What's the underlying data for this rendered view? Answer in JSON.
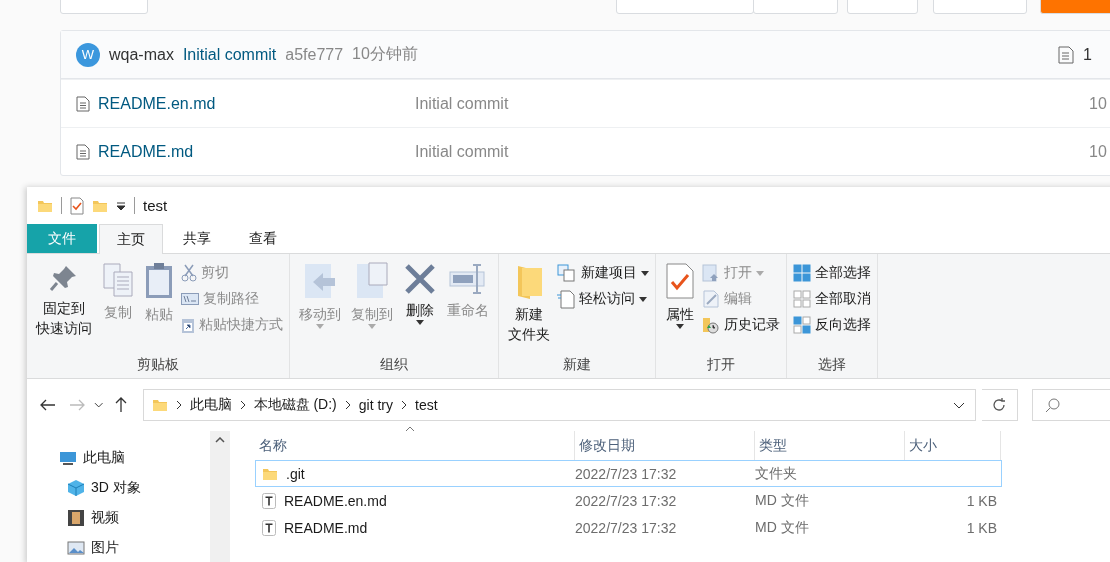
{
  "repo": {
    "commit": {
      "avatar": "W",
      "author": "wqa-max",
      "message": "Initial commit",
      "hash": "a5fe777",
      "time": "10分钟前",
      "count": "1"
    },
    "files": [
      {
        "name": "README.en.md",
        "message": "Initial commit",
        "time": "10"
      },
      {
        "name": "README.md",
        "message": "Initial commit",
        "time": "10"
      }
    ]
  },
  "explorer": {
    "title": "test",
    "tabs": [
      {
        "label": "文件",
        "kind": "file",
        "selected": false
      },
      {
        "label": "主页",
        "kind": "tab",
        "selected": true
      },
      {
        "label": "共享",
        "kind": "tab",
        "selected": false
      },
      {
        "label": "查看",
        "kind": "tab",
        "selected": false
      }
    ],
    "ribbon_groups": [
      {
        "label": "剪贴板",
        "columns": [
          {
            "kind": "large",
            "items": [
              {
                "lines": [
                  "固定到",
                  "快速访问"
                ],
                "disabled": false,
                "dropdown": false
              }
            ]
          },
          {
            "kind": "large",
            "items": [
              {
                "lines": [
                  "复制"
                ],
                "disabled": true,
                "dropdown": false
              }
            ]
          },
          {
            "kind": "large",
            "items": [
              {
                "lines": [
                  "粘贴"
                ],
                "disabled": true,
                "dropdown": false
              }
            ]
          },
          {
            "kind": "stack",
            "items": [
              {
                "label": "剪切",
                "disabled": true,
                "dropdown": false
              },
              {
                "label": "复制路径",
                "disabled": true,
                "dropdown": false
              },
              {
                "label": "粘贴快捷方式",
                "disabled": true,
                "dropdown": false
              }
            ]
          }
        ]
      },
      {
        "label": "组织",
        "columns": [
          {
            "kind": "large",
            "items": [
              {
                "lines": [
                  "移动到"
                ],
                "disabled": true,
                "dropdown": true
              }
            ]
          },
          {
            "kind": "large",
            "items": [
              {
                "lines": [
                  "复制到"
                ],
                "disabled": true,
                "dropdown": true
              }
            ]
          },
          {
            "kind": "large",
            "items": [
              {
                "lines": [
                  "删除"
                ],
                "disabled": false,
                "dropdown": true
              }
            ]
          },
          {
            "kind": "large",
            "items": [
              {
                "lines": [
                  "重命名"
                ],
                "disabled": true,
                "dropdown": false
              }
            ]
          }
        ]
      },
      {
        "label": "新建",
        "columns": [
          {
            "kind": "large",
            "items": [
              {
                "lines": [
                  "新建",
                  "文件夹"
                ],
                "disabled": false,
                "dropdown": false
              }
            ]
          },
          {
            "kind": "stack",
            "items": [
              {
                "label": "新建项目",
                "disabled": false,
                "dropdown": true
              },
              {
                "label": "轻松访问",
                "disabled": false,
                "dropdown": true
              }
            ]
          }
        ]
      },
      {
        "label": "打开",
        "columns": [
          {
            "kind": "large",
            "items": [
              {
                "lines": [
                  "属性"
                ],
                "disabled": false,
                "dropdown": true
              }
            ]
          },
          {
            "kind": "stack",
            "items": [
              {
                "label": "打开",
                "disabled": true,
                "dropdown": true
              },
              {
                "label": "编辑",
                "disabled": true,
                "dropdown": false
              },
              {
                "label": "历史记录",
                "disabled": false,
                "dropdown": false
              }
            ]
          }
        ]
      },
      {
        "label": "选择",
        "columns": [
          {
            "kind": "stack",
            "items": [
              {
                "label": "全部选择",
                "disabled": false,
                "dropdown": false
              },
              {
                "label": "全部取消",
                "disabled": false,
                "dropdown": false
              },
              {
                "label": "反向选择",
                "disabled": false,
                "dropdown": false
              }
            ]
          }
        ]
      }
    ],
    "path": [
      "此电脑",
      "本地磁盘 (D:)",
      "git try",
      "test"
    ],
    "nav": [
      {
        "label": "此电脑",
        "children": [
          {
            "label": "3D 对象"
          },
          {
            "label": "视频"
          },
          {
            "label": "图片"
          }
        ]
      }
    ],
    "columns": [
      {
        "label": "名称",
        "sorted": true
      },
      {
        "label": "修改日期",
        "sorted": false
      },
      {
        "label": "类型",
        "sorted": false
      },
      {
        "label": "大小",
        "sorted": false
      }
    ],
    "rows": [
      {
        "name": ".git",
        "modified": "2022/7/23 17:32",
        "type": "文件夹",
        "kind": "folder",
        "selected": true
      },
      {
        "name": "README.en.md",
        "modified": "2022/7/23 17:32",
        "type": "MD 文件",
        "size": "1 KB",
        "kind": "text",
        "selected": false
      },
      {
        "name": "README.md",
        "modified": "2022/7/23 17:32",
        "type": "MD 文件",
        "size": "1 KB",
        "kind": "text",
        "selected": false
      }
    ]
  }
}
